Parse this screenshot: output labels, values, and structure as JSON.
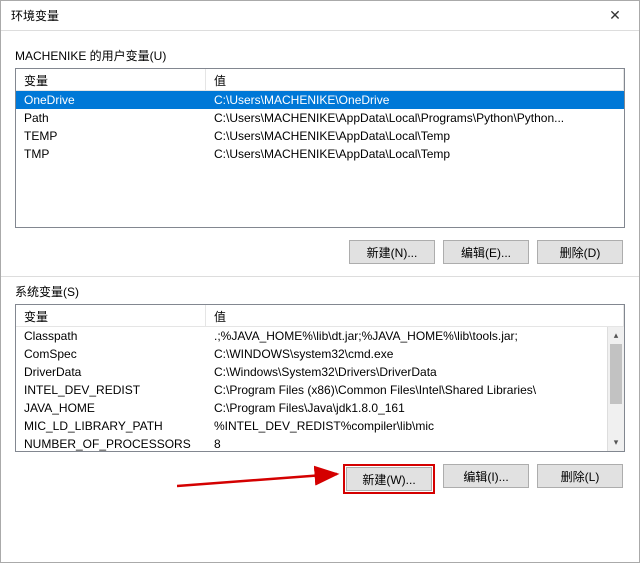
{
  "window": {
    "title": "环境变量"
  },
  "userSection": {
    "label": "MACHENIKE 的用户变量(U)",
    "columns": {
      "name": "变量",
      "value": "值"
    },
    "rows": [
      {
        "name": "OneDrive",
        "value": "C:\\Users\\MACHENIKE\\OneDrive",
        "selected": true
      },
      {
        "name": "Path",
        "value": "C:\\Users\\MACHENIKE\\AppData\\Local\\Programs\\Python\\Python..."
      },
      {
        "name": "TEMP",
        "value": "C:\\Users\\MACHENIKE\\AppData\\Local\\Temp"
      },
      {
        "name": "TMP",
        "value": "C:\\Users\\MACHENIKE\\AppData\\Local\\Temp"
      }
    ],
    "buttons": {
      "new": "新建(N)...",
      "edit": "编辑(E)...",
      "delete": "删除(D)"
    }
  },
  "systemSection": {
    "label": "系统变量(S)",
    "columns": {
      "name": "变量",
      "value": "值"
    },
    "rows": [
      {
        "name": "Classpath",
        "value": ".;%JAVA_HOME%\\lib\\dt.jar;%JAVA_HOME%\\lib\\tools.jar;"
      },
      {
        "name": "ComSpec",
        "value": "C:\\WINDOWS\\system32\\cmd.exe"
      },
      {
        "name": "DriverData",
        "value": "C:\\Windows\\System32\\Drivers\\DriverData"
      },
      {
        "name": "INTEL_DEV_REDIST",
        "value": "C:\\Program Files (x86)\\Common Files\\Intel\\Shared Libraries\\"
      },
      {
        "name": "JAVA_HOME",
        "value": "C:\\Program Files\\Java\\jdk1.8.0_161"
      },
      {
        "name": "MIC_LD_LIBRARY_PATH",
        "value": "%INTEL_DEV_REDIST%compiler\\lib\\mic"
      },
      {
        "name": "NUMBER_OF_PROCESSORS",
        "value": "8"
      }
    ],
    "buttons": {
      "new": "新建(W)...",
      "edit": "编辑(I)...",
      "delete": "删除(L)"
    }
  }
}
